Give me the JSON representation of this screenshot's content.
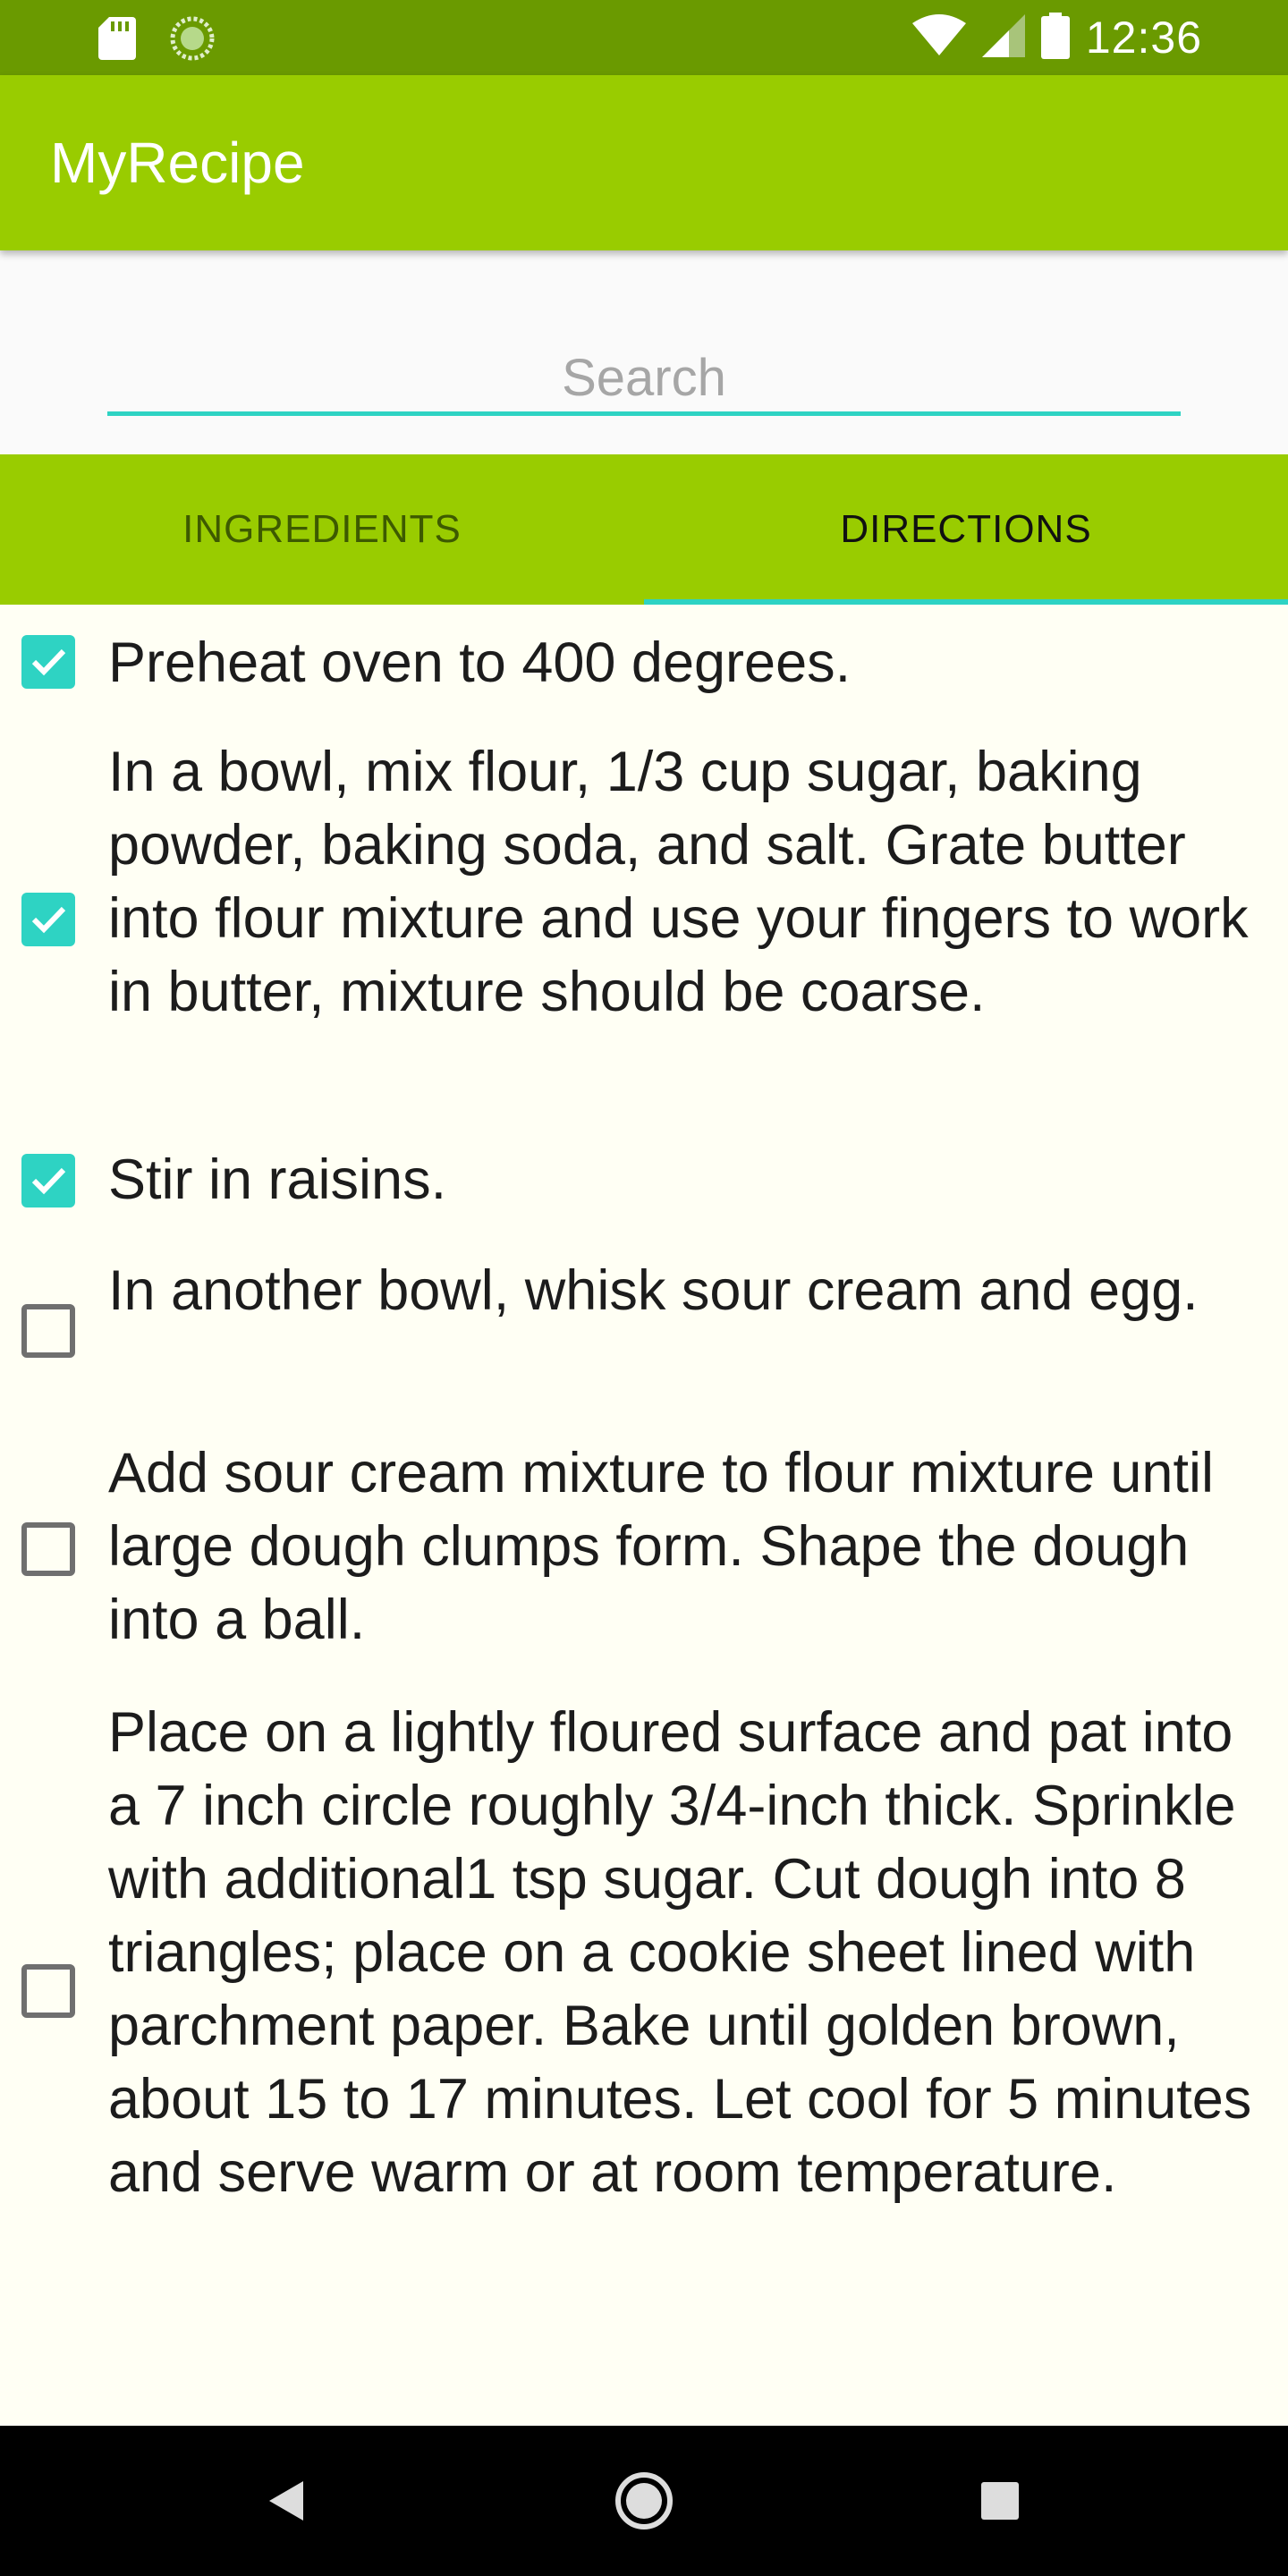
{
  "status_bar": {
    "time": "12:36",
    "icons": [
      "sd-card-icon",
      "sync-icon",
      "wifi-icon",
      "signal-icon",
      "battery-icon"
    ]
  },
  "app_bar": {
    "title": "MyRecipe"
  },
  "search": {
    "placeholder": "Search",
    "value": ""
  },
  "tabs": [
    {
      "label": "INGREDIENTS",
      "selected": false
    },
    {
      "label": "DIRECTIONS",
      "selected": true
    }
  ],
  "colors": {
    "status_bar": "#6a9a00",
    "app_bar": "#99cc00",
    "accent": "#2ed3c3",
    "background": "#fffff4"
  },
  "directions": [
    {
      "text": "Preheat oven to 400 degrees.",
      "checked": true
    },
    {
      "text": "In a bowl, mix flour, 1/3 cup sugar, baking powder, baking soda, and salt. Grate butter into flour mixture and use your fingers to work in butter, mixture should be coarse.",
      "checked": true
    },
    {
      "text": "Stir in raisins.",
      "checked": true
    },
    {
      "text": "In another bowl, whisk sour cream and egg.",
      "checked": false
    },
    {
      "text": "Add sour cream mixture to flour mixture until large dough clumps form. Shape the dough into a ball.",
      "checked": false
    },
    {
      "text": "Place on a lightly floured surface and pat into a 7 inch circle roughly 3/4-inch thick. Sprinkle with additional1 tsp sugar. Cut dough into 8 triangles; place on a cookie sheet lined with parchment paper. Bake until golden brown, about 15 to 17 minutes. Let cool for 5 minutes and serve warm or at room temperature.",
      "checked": false
    }
  ],
  "nav_bar": {
    "buttons": [
      "back-icon",
      "home-icon",
      "recents-icon"
    ]
  }
}
